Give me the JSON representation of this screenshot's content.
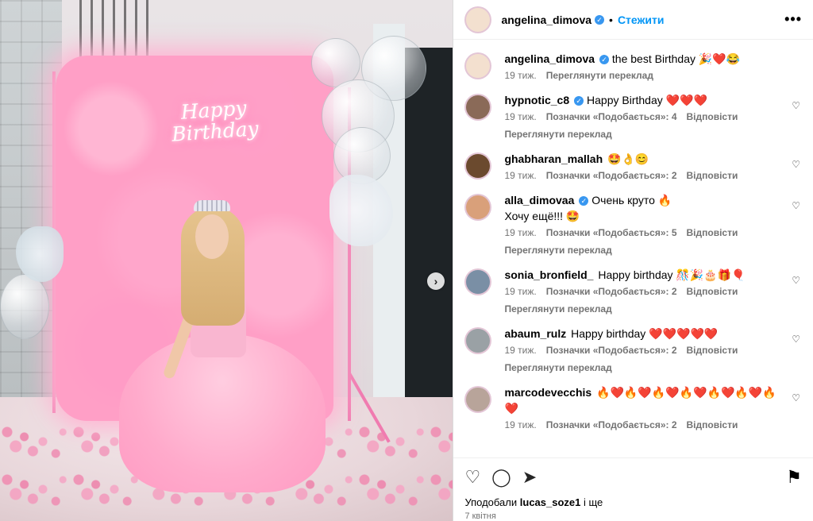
{
  "header": {
    "username": "angelina_dimova",
    "follow_label": "Стежити",
    "more_icon": "•••"
  },
  "media": {
    "neon_text": "Happy Birthday",
    "next_icon": "›"
  },
  "caption": {
    "username": "angelina_dimova",
    "text": "the best Birthday 🎉❤️😂",
    "time": "19 тиж.",
    "translate": "Переглянути переклад"
  },
  "comments": [
    {
      "username": "hypnotic_c8",
      "verified": true,
      "text": "Happy Birthday ❤️❤️❤️",
      "time": "19 тиж.",
      "likes": "Позначки «Подобається»: 4",
      "reply": "Відповісти",
      "translate": "Переглянути переклад",
      "avatar_color": "#8a6a58"
    },
    {
      "username": "ghabharan_mallah",
      "verified": false,
      "text": "🤩👌😊",
      "time": "19 тиж.",
      "likes": "Позначки «Подобається»: 2",
      "reply": "Відповісти",
      "translate": "",
      "avatar_color": "#6b4a2e"
    },
    {
      "username": "alla_dimovaa",
      "verified": true,
      "text": "Очень круто 🔥\nХочу ещё!!! 🤩",
      "time": "19 тиж.",
      "likes": "Позначки «Подобається»: 5",
      "reply": "Відповісти",
      "translate": "Переглянути переклад",
      "avatar_color": "#d9a07a"
    },
    {
      "username": "sonia_bronfield_",
      "verified": false,
      "text": "Happy birthday 🎊🎉🎂🎁🎈",
      "time": "19 тиж.",
      "likes": "Позначки «Подобається»: 2",
      "reply": "Відповісти",
      "translate": "Переглянути переклад",
      "avatar_color": "#7a8fa5"
    },
    {
      "username": "abaum_rulz",
      "verified": false,
      "text": "Happy birthday ❤️❤️❤️❤️❤️",
      "time": "19 тиж.",
      "likes": "Позначки «Подобається»: 2",
      "reply": "Відповісти",
      "translate": "Переглянути переклад",
      "avatar_color": "#9aa1a5"
    },
    {
      "username": "marcodevecchis",
      "verified": false,
      "text": "🔥❤️🔥❤️🔥❤️🔥❤️🔥❤️🔥❤️🔥❤️",
      "time": "19 тиж.",
      "likes": "Позначки «Подобається»: 2",
      "reply": "Відповісти",
      "translate": "",
      "avatar_color": "#b8a49a"
    }
  ],
  "actions": {
    "like_icon": "♡",
    "comment_icon": "◯",
    "share_icon": "➤",
    "save_icon": "⚑"
  },
  "likes_line": {
    "prefix": "Уподобали",
    "user": "lucas_soze1",
    "suffix": "і ще"
  },
  "date": "7 квітня"
}
